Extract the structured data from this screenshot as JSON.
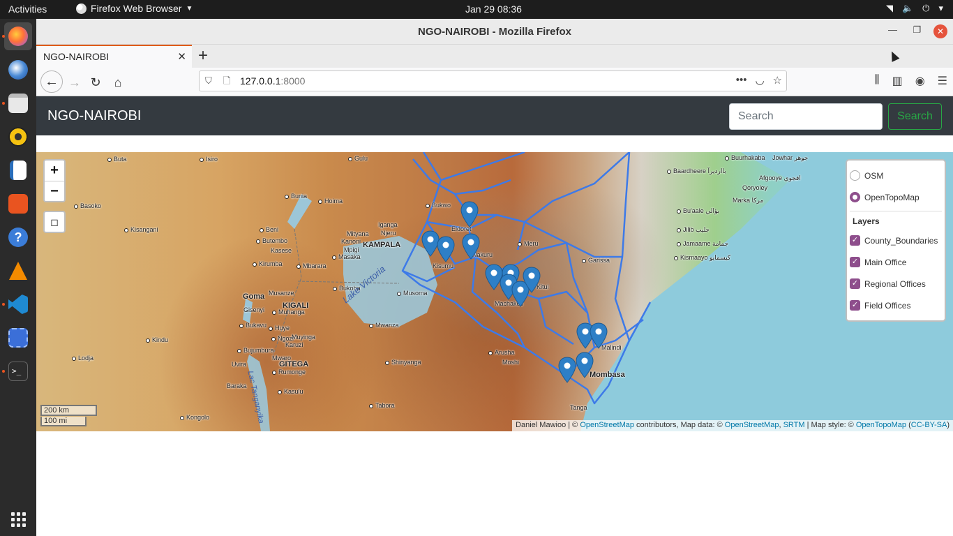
{
  "topbar": {
    "activities": "Activities",
    "app_name": "Firefox Web Browser",
    "clock": "Jan 29  08:36"
  },
  "window": {
    "title": "NGO-NAIROBI - Mozilla Firefox",
    "tab_label": "NGO-NAIROBI",
    "url_host": "127.0.0.1",
    "url_port": ":8000"
  },
  "site": {
    "brand": "NGO-NAIROBI",
    "search_placeholder": "Search",
    "search_button": "Search"
  },
  "map": {
    "zoom_in": "+",
    "zoom_out": "−",
    "base_layers": [
      {
        "label": "OSM",
        "selected": false
      },
      {
        "label": "OpenTopoMap",
        "selected": true
      }
    ],
    "layers_header": "Layers",
    "overlays": [
      {
        "label": "County_Boundaries",
        "checked": true
      },
      {
        "label": "Main Office",
        "checked": true
      },
      {
        "label": "Regional Offices",
        "checked": true
      },
      {
        "label": "Field Offices",
        "checked": true
      }
    ],
    "scale_km": "200 km",
    "scale_mi": "100 mi",
    "attribution": {
      "author": "Daniel Mawioo | © ",
      "osm1": "OpenStreetMap",
      "mid": " contributors, Map data: © ",
      "osm2": "OpenStreetMap",
      "sep": ", ",
      "srtm": "SRTM",
      "style": " | Map style: © ",
      "otm": "OpenTopoMap",
      "lic_open": " (",
      "license": "CC-BY-SA",
      "lic_close": ")"
    },
    "places": {
      "buta": "Buta",
      "isiro": "Isiro",
      "gulu": "Gulu",
      "buurhakaba": "Buurhakaba",
      "jowhar": "Jowhar جوهر",
      "baardheere": "Baardheere بااردیرآ",
      "afgooye": "Afgooye افجوي",
      "qoryoley": "Qoryoley",
      "marka": "Marka مركا",
      "bunia": "Bunia",
      "hoima": "Hoima",
      "basoko": "Basoko",
      "kisangani": "Kisangani",
      "beni": "Beni",
      "butembo": "Butembo",
      "kasese": "Kasese",
      "mityana": "Mityana",
      "iganga": "Iganga",
      "njeru": "Njeru",
      "kanoni": "Kanoni",
      "mpigi": "Mpigi",
      "masaka": "Masaka",
      "kampala": "KAMPALA",
      "bukwo": "Bukwo",
      "eldoret": "Eldoret",
      "meru": "Meru",
      "buaale": "Bu'aale بؤالي",
      "jilib": "Jilib جليب",
      "jamaame": "Jamaame جمامة",
      "kismaayo": "Kismaayo كيسمايو",
      "garissa": "Garissa",
      "kirumba": "Kirumba",
      "mbarara": "Mbarara",
      "bukoba": "Bukoba",
      "musoma": "Musoma",
      "goma": "Goma",
      "musanze": "Musanze",
      "kigali": "KIGALI",
      "gisenyi": "Gisenyi",
      "muhanga": "Muhanga",
      "bukavu": "Bukavu",
      "huye": "Huye",
      "ngozi": "Ngozi",
      "muyinga": "Muyinga",
      "karuzi": "Karuzi",
      "bujumbura": "Bujumbura",
      "uvira": "Uvira",
      "mwaro": "Mwaro",
      "gitega": "GITEGA",
      "rumonge": "Rumonge",
      "mwanza": "Mwanza",
      "kindu": "Kindu",
      "lodja": "Lodja",
      "arusha": "Arusha",
      "moshi": "Moshi",
      "shinyanga": "Shinyanga",
      "malindi": "Malindi",
      "mombasa": "Mombasa",
      "baraka": "Baraka",
      "kasulu": "Kasulu",
      "tabora": "Tabora",
      "tanga": "Tanga",
      "kongolo": "Kongolo",
      "kitui": "Kitui",
      "machakos": "Machakos",
      "nakuru": "Nakuru",
      "kisumu": "Kisumu",
      "lake_victoria": "Lake Victoria",
      "lake_tanganyika": "Lac Tanganyika"
    }
  }
}
